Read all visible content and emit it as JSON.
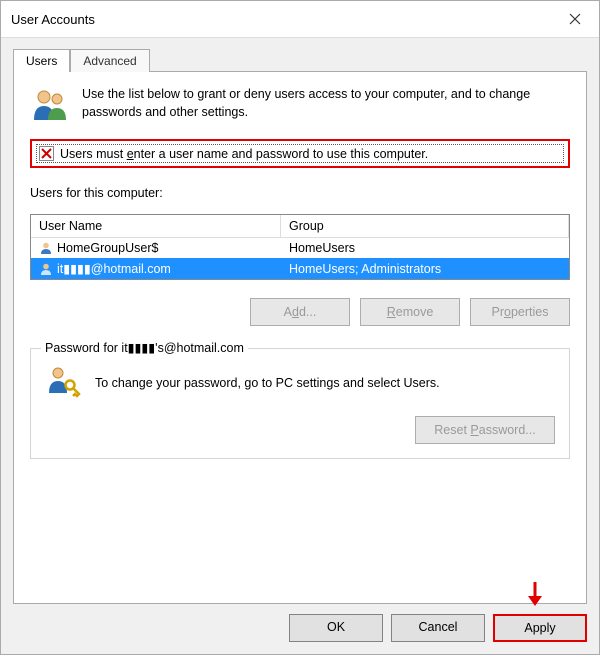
{
  "window": {
    "title": "User Accounts"
  },
  "tabs": {
    "users": "Users",
    "advanced": "Advanced"
  },
  "intro": {
    "text": "Use the list below to grant or deny users access to your computer, and to change passwords and other settings."
  },
  "checkbox": {
    "checked_state": "indeterminate-red-x",
    "label_pre": "Users must ",
    "label_ul": "e",
    "label_post": "nter a user name and password to use this computer."
  },
  "listview": {
    "caption": "Users for this computer:",
    "headers": {
      "username": "User Name",
      "group": "Group"
    },
    "rows": [
      {
        "username": "HomeGroupUser$",
        "group": "HomeUsers",
        "selected": false
      },
      {
        "username": "it▮▮▮▮@hotmail.com",
        "group": "HomeUsers; Administrators",
        "selected": true
      }
    ]
  },
  "user_buttons": {
    "add": "Add...",
    "remove": "Remove",
    "properties": "Properties"
  },
  "password_group": {
    "caption": "Password for it▮▮▮▮'s@hotmail.com",
    "text": "To change your password, go to PC settings and select Users.",
    "reset": "Reset Password..."
  },
  "dialog_buttons": {
    "ok": "OK",
    "cancel": "Cancel",
    "apply": "Apply"
  }
}
